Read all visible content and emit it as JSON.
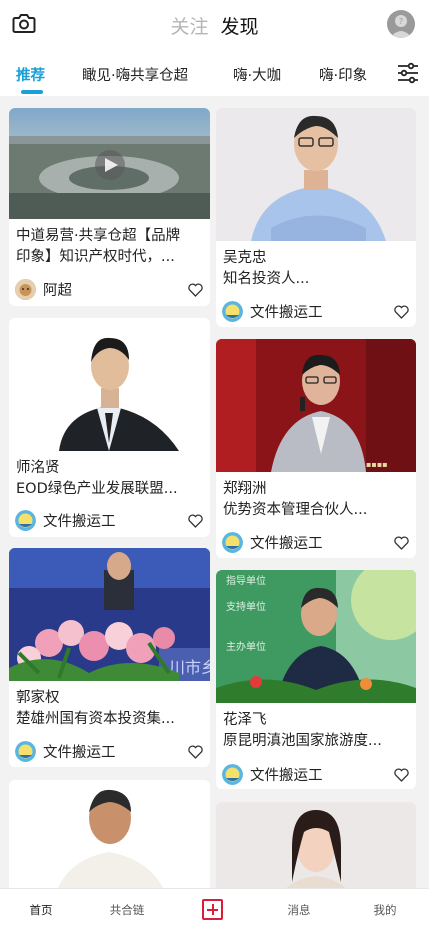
{
  "header": {
    "tab_follow": "关注",
    "tab_discover": "发现",
    "camera_icon": "camera-icon",
    "profile_icon": "user-avatar-icon"
  },
  "categories": {
    "items": [
      {
        "label": "推荐",
        "active": true
      },
      {
        "label": "瞰见·嗨共享仓超",
        "active": false
      },
      {
        "label": "嗨·大咖",
        "active": false
      },
      {
        "label": "嗨·印象",
        "active": false
      }
    ],
    "filter_icon": "sliders-icon",
    "accent_color": "#1aa0d8"
  },
  "feed": {
    "left": [
      {
        "title_lines": [
          "中道易营·共享仓超【品牌",
          "印象】知识产权时代，..."
        ],
        "author": "阿超",
        "has_video": true
      },
      {
        "title_lines": [
          "师洺贤",
          "EOD绿色产业发展联盟..."
        ],
        "author": "文件搬运工",
        "has_video": false
      },
      {
        "title_lines": [
          "郭家权",
          "楚雄州国有资本投资集..."
        ],
        "author": "文件搬运工",
        "has_video": false
      },
      {
        "title_lines": [
          "",
          ""
        ],
        "author": "",
        "has_video": false
      }
    ],
    "right": [
      {
        "title_lines": [
          "吴克忠",
          "知名投资人..."
        ],
        "author": "文件搬运工"
      },
      {
        "title_lines": [
          "郑翔洲",
          "优势资本管理合伙人..."
        ],
        "author": "文件搬运工"
      },
      {
        "title_lines": [
          "花泽飞",
          "原昆明滇池国家旅游度..."
        ],
        "author": "文件搬运工"
      },
      {
        "title_lines": [
          "",
          ""
        ],
        "author": ""
      }
    ]
  },
  "bottom_nav": {
    "home": "首页",
    "chain": "共合链",
    "add_icon": "plus-square-icon",
    "messages": "消息",
    "mine": "我的",
    "accent_color": "#d81e3c"
  }
}
